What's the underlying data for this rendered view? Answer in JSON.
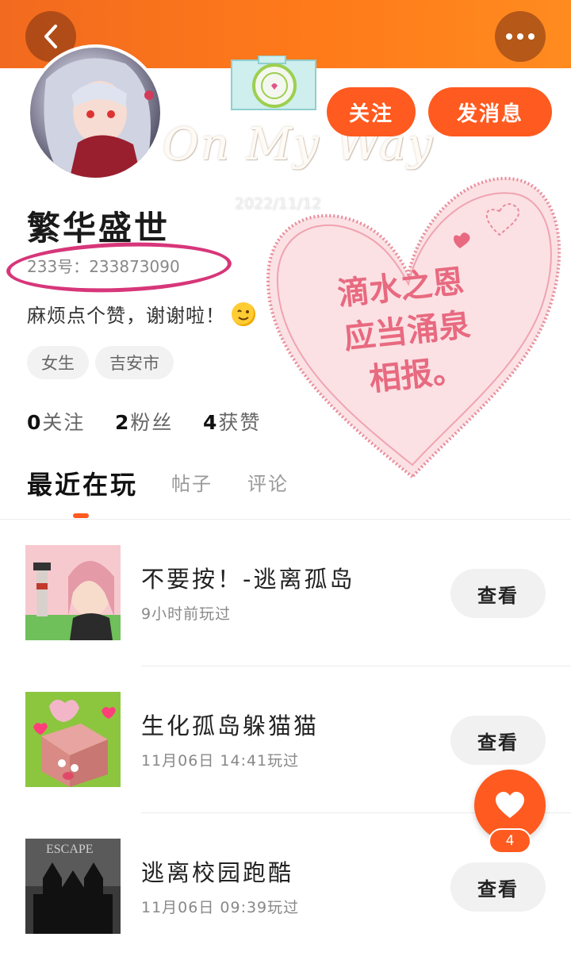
{
  "profile": {
    "username": "繁华盛世",
    "id_label": "233号：",
    "id_value": "233873090",
    "bio": "麻烦点个赞，谢谢啦！",
    "tags": [
      "女生",
      "吉安市"
    ],
    "stats": {
      "following_count": "0",
      "following_label": "关注",
      "fans_count": "2",
      "fans_label": "粉丝",
      "likes_count": "4",
      "likes_label": "获赞"
    }
  },
  "actions": {
    "follow_label": "关注",
    "message_label": "发消息"
  },
  "sticker": {
    "script_text": "On My Way",
    "date_text": "2022/11/12",
    "heart_line1": "滴水之恩",
    "heart_line2": "应当涌泉",
    "heart_line3": "相报。"
  },
  "tabs": [
    {
      "label": "最近在玩",
      "active": true
    },
    {
      "label": "帖子",
      "active": false
    },
    {
      "label": "评论",
      "active": false
    }
  ],
  "games": [
    {
      "title": "不要按！-逃离孤岛",
      "time": "9小时前玩过",
      "button": "查看"
    },
    {
      "title": "生化孤岛躲猫猫",
      "time": "11月06日 14:41玩过",
      "button": "查看"
    },
    {
      "title": "逃离校园跑酷",
      "time": "11月06日 09:39玩过",
      "button": "查看"
    }
  ],
  "third_thumb_text": "ESCAPE",
  "fab": {
    "badge_count": "4"
  },
  "colors": {
    "accent": "#ff5a1f",
    "header": "#f26a1f",
    "oval": "#d7367a",
    "heart_text": "#e86a80"
  },
  "icons": {
    "back": "chevron-left-icon",
    "more": "more-dots-icon",
    "fab": "heart-icon"
  }
}
